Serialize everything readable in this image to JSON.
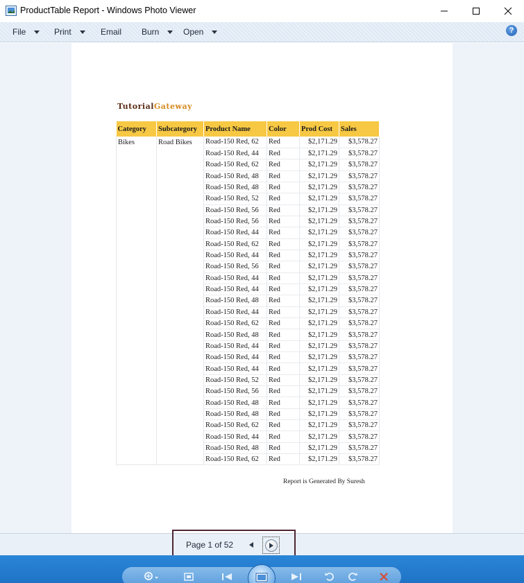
{
  "window": {
    "title": "ProductTable Report - Windows Photo Viewer"
  },
  "menu": {
    "file": "File",
    "print": "Print",
    "email": "Email",
    "burn": "Burn",
    "open": "Open",
    "help": "?"
  },
  "report": {
    "logo_part1": "Tutorial",
    "logo_part2": "Gateway",
    "headers": [
      "Category",
      "Subcategory",
      "Product Name",
      "Color",
      "Prod Cost",
      "Sales"
    ],
    "category": "Bikes",
    "subcategory": "Road Bikes",
    "rows": [
      [
        "Road-150 Red, 62",
        "Red",
        "$2,171.29",
        "$3,578.27"
      ],
      [
        "Road-150 Red, 44",
        "Red",
        "$2,171.29",
        "$3,578.27"
      ],
      [
        "Road-150 Red, 62",
        "Red",
        "$2,171.29",
        "$3,578.27"
      ],
      [
        "Road-150 Red, 48",
        "Red",
        "$2,171.29",
        "$3,578.27"
      ],
      [
        "Road-150 Red, 48",
        "Red",
        "$2,171.29",
        "$3,578.27"
      ],
      [
        "Road-150 Red, 52",
        "Red",
        "$2,171.29",
        "$3,578.27"
      ],
      [
        "Road-150 Red, 56",
        "Red",
        "$2,171.29",
        "$3,578.27"
      ],
      [
        "Road-150 Red, 56",
        "Red",
        "$2,171.29",
        "$3,578.27"
      ],
      [
        "Road-150 Red, 44",
        "Red",
        "$2,171.29",
        "$3,578.27"
      ],
      [
        "Road-150 Red, 62",
        "Red",
        "$2,171.29",
        "$3,578.27"
      ],
      [
        "Road-150 Red, 44",
        "Red",
        "$2,171.29",
        "$3,578.27"
      ],
      [
        "Road-150 Red, 56",
        "Red",
        "$2,171.29",
        "$3,578.27"
      ],
      [
        "Road-150 Red, 44",
        "Red",
        "$2,171.29",
        "$3,578.27"
      ],
      [
        "Road-150 Red, 44",
        "Red",
        "$2,171.29",
        "$3,578.27"
      ],
      [
        "Road-150 Red, 48",
        "Red",
        "$2,171.29",
        "$3,578.27"
      ],
      [
        "Road-150 Red, 44",
        "Red",
        "$2,171.29",
        "$3,578.27"
      ],
      [
        "Road-150 Red, 62",
        "Red",
        "$2,171.29",
        "$3,578.27"
      ],
      [
        "Road-150 Red, 48",
        "Red",
        "$2,171.29",
        "$3,578.27"
      ],
      [
        "Road-150 Red, 44",
        "Red",
        "$2,171.29",
        "$3,578.27"
      ],
      [
        "Road-150 Red, 44",
        "Red",
        "$2,171.29",
        "$3,578.27"
      ],
      [
        "Road-150 Red, 44",
        "Red",
        "$2,171.29",
        "$3,578.27"
      ],
      [
        "Road-150 Red, 52",
        "Red",
        "$2,171.29",
        "$3,578.27"
      ],
      [
        "Road-150 Red, 56",
        "Red",
        "$2,171.29",
        "$3,578.27"
      ],
      [
        "Road-150 Red, 48",
        "Red",
        "$2,171.29",
        "$3,578.27"
      ],
      [
        "Road-150 Red, 48",
        "Red",
        "$2,171.29",
        "$3,578.27"
      ],
      [
        "Road-150 Red, 62",
        "Red",
        "$2,171.29",
        "$3,578.27"
      ],
      [
        "Road-150 Red, 44",
        "Red",
        "$2,171.29",
        "$3,578.27"
      ],
      [
        "Road-150 Red, 48",
        "Red",
        "$2,171.29",
        "$3,578.27"
      ],
      [
        "Road-150 Red, 62",
        "Red",
        "$2,171.29",
        "$3,578.27"
      ]
    ],
    "footer": "Report is Generated By Suresh"
  },
  "pager": {
    "label": "Page 1 of 52"
  },
  "toolbar_icons": [
    "zoom-icon",
    "actual-size-icon",
    "previous-icon",
    "slideshow-icon",
    "next-icon",
    "rotate-counterclockwise-icon",
    "rotate-clockwise-icon",
    "delete-icon"
  ],
  "colors": {
    "header_bg": "#f7c843",
    "taskbar": "#1f73c6",
    "logo_dark": "#5a2a14",
    "logo_light": "#d68a1f",
    "pager_highlight": "#4e2633"
  }
}
